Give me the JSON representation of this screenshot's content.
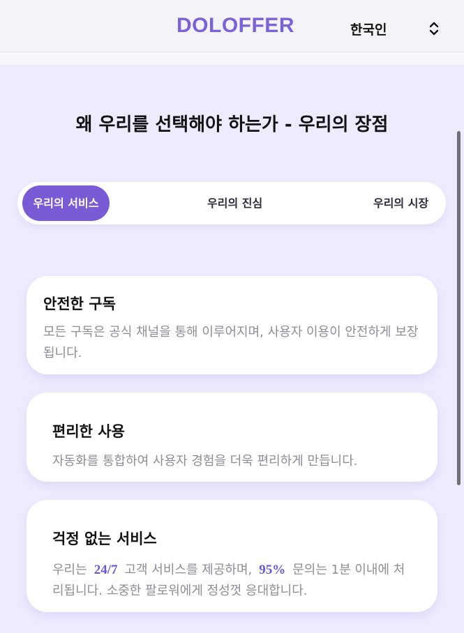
{
  "header": {
    "brand": "DOLOFFER",
    "language": "한국인",
    "language_icon": "chevron-updown-icon"
  },
  "main": {
    "title": "왜 우리를 선택해야 하는가 - 우리의 장점",
    "tabs": [
      {
        "label": "우리의 서비스",
        "active": true
      },
      {
        "label": "우리의 진심",
        "active": false
      },
      {
        "label": "우리의 시장",
        "active": false
      }
    ],
    "cards": [
      {
        "title": "안전한 구독",
        "desc": "모든 구독은 공식 채널을 통해 이루어지며, 사용자 이용이 안전하게 보장됩니다."
      },
      {
        "title": "편리한 사용",
        "desc": "자동화를 통합하여 사용자 경험을 더욱 편리하게 만듭니다."
      },
      {
        "title": "걱정 없는 서비스",
        "desc_part1": "우리는",
        "highlight1": "24/7",
        "desc_part2": "고객 서비스를 제공하며,",
        "highlight2": "95%",
        "desc_part3": "문의는 1분 이내에 처리됩니다. 소중한 팔로워에게 정성껏 응대합니다."
      }
    ]
  },
  "colors": {
    "accent": "#7a5bd6",
    "brand": "#7c62d8",
    "background": "#efebff",
    "highlight": "#6c54d4"
  }
}
